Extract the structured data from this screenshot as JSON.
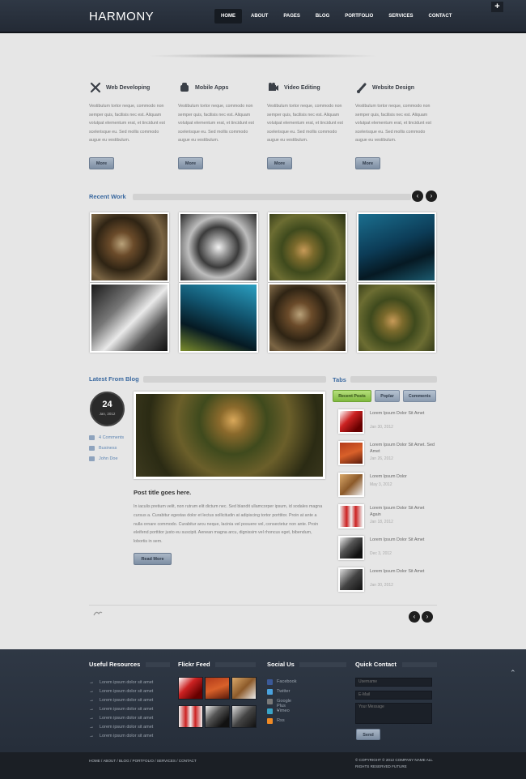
{
  "header": {
    "logo": "HARMONY",
    "nav": [
      "HOME",
      "ABOUT",
      "PAGES",
      "BLOG",
      "PORTFOLIO",
      "SERVICES",
      "CONTACT"
    ],
    "plus_label": "+"
  },
  "services": [
    {
      "title": "Web Developing",
      "icon": "tools-icon",
      "text": "Vestibulum tortor neque, commodo non semper quis, facilisis nec est. Aliquam volutpat elementum erat, et tincidunt est scelerisque eu. Sed mollis commodo augue eu vestibulum.",
      "button": "More"
    },
    {
      "title": "Mobile Apps",
      "icon": "robot-icon",
      "text": "Vestibulum tortor neque, commodo non semper quis, facilisis nec est. Aliquam volutpat elementum erat, et tincidunt est scelerisque eu. Sed mollis commodo augue eu vestibulum.",
      "button": "More"
    },
    {
      "title": "Video Editing",
      "icon": "camera-icon",
      "text": "Vestibulum tortor neque, commodo non semper quis, facilisis nec est. Aliquam volutpat elementum erat, et tincidunt est scelerisque eu. Sed mollis commodo augue eu vestibulum.",
      "button": "More"
    },
    {
      "title": "Website Design",
      "icon": "brush-icon",
      "text": "Vestibulum tortor neque, commodo non semper quis, facilisis nec est. Aliquam volutpat elementum erat, et tincidunt est scelerisque eu. Sed mollis commodo augue eu vestibulum.",
      "button": "More"
    }
  ],
  "recent_work": {
    "title": "Recent Work",
    "prev": "‹",
    "next": "›"
  },
  "blog": {
    "title": "Latest From Blog",
    "day": "24",
    "month": "Jan, 2012",
    "comments": "4 Comments",
    "category": "Business",
    "author": "John Doe",
    "post_title": "Post title goes here.",
    "post_text": "In iaculis pretium velit, non rutrum elit dictum nec. Sed blandit ullamcorper ipsum, id sodales magna cursus a. Curabitur egestas dolor et lectus sollicitudin at adipiscing tortor porttitor. Proin at ante a nulla ornare commodo. Curabitur arcu neque, lacinia vel posuere vel, consectetur non ante. Proin eleifend porttitor justo eu suscipit. Aenean magna arcu, dignissim vel rhoncus eget, bibendum, lobortis in sem.",
    "read_more": "Read More"
  },
  "tabs": {
    "title": "Tabs",
    "labels": [
      "Recent Posts",
      "Poplar",
      "Comments"
    ],
    "posts": [
      {
        "title": "Lorem Ipsum Dolor Sit Amet",
        "date": "Jan 30, 2012"
      },
      {
        "title": "Lorem Ipsum Dolor Sit Amet. Sed Amet",
        "date": "Jan 26, 2012"
      },
      {
        "title": "Lorem Ipsum Dolor",
        "date": "May 3, 2012"
      },
      {
        "title": "Lorem Ipsum Dolor Sit Amet Again",
        "date": "Jan 18, 2012"
      },
      {
        "title": "Lorem Ipsum Dolor Sit Amet",
        "date": "Dec 3, 2012"
      },
      {
        "title": "Lorem Ipsum Dolor Sit Amet",
        "date": "Jan 30, 2012"
      }
    ]
  },
  "footer": {
    "useful_title": "Useful Resources",
    "useful_items": [
      "Lorem ipsum dolor sit amet",
      "Lorem ipsum dolor sit amet",
      "Lorem ipsum dolor sit amet",
      "Lorem ipsum dolor sit amet",
      "Lorem ipsum dolor sit amet",
      "Lorem ipsum dolor sit amet",
      "Lorem ipsum dolor sit amet"
    ],
    "flickr_title": "Flickr Feed",
    "social_title": "Social Us",
    "social_items": [
      "Facebook",
      "Twitter",
      "Google Plus +",
      "Vimeo",
      "Rss"
    ],
    "social_colors": [
      "#3b5998",
      "#4aa3df",
      "#7a7a7a",
      "#3aa3c6",
      "#f08a24"
    ],
    "contact_title": "Quick Contact",
    "username_placeholder": "Username",
    "email_placeholder": "E-Mail",
    "message_placeholder": "Your Message",
    "send": "Send",
    "bottom_nav": "HOME  /  ABOUT  /  BLOG  /  PORTFOLIO  /  SERVICES  /  CONTACT",
    "copyright": "© COPYRIGHT © 2012 COMPANY NAME ALL RIGHTS RESERVED FUTURE"
  }
}
